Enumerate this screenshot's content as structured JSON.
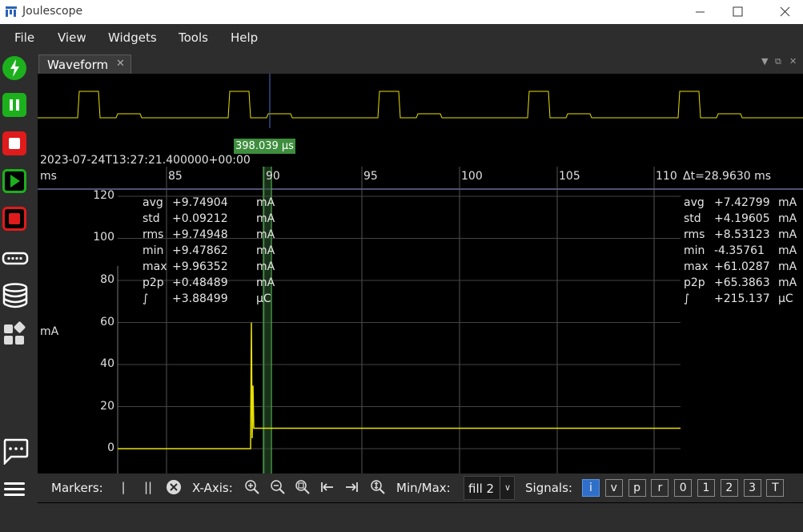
{
  "window": {
    "title": "Joulescope",
    "minimize": "—",
    "maximize": "☐",
    "close": "✕"
  },
  "menu": [
    "File",
    "View",
    "Widgets",
    "Tools",
    "Help"
  ],
  "sidebar": [
    {
      "name": "energy-icon",
      "color": "#1db01d"
    },
    {
      "name": "pause-icon",
      "color": "#1db01d"
    },
    {
      "name": "stop-icon",
      "color": "#e01b1b"
    },
    {
      "name": "play-icon",
      "color": "#1db01d"
    },
    {
      "name": "record-icon",
      "color": "#e01b1b"
    },
    {
      "name": "device-icon",
      "color": "#ffffff"
    },
    {
      "name": "database-icon",
      "color": "#ffffff"
    },
    {
      "name": "widgets-icon",
      "color": "#ffffff"
    },
    {
      "name": "chat-icon",
      "color": "#ffffff"
    },
    {
      "name": "hamburger-menu-icon",
      "color": "#ffffff"
    }
  ],
  "tab": {
    "label": "Waveform",
    "close": "✕"
  },
  "waveform": {
    "marker_flag": "398.039 µs",
    "timestamp": "2023-07-24T13:27:21.400000+00:00",
    "x_unit": "ms",
    "x_ticks": [
      "85",
      "90",
      "95",
      "100",
      "105",
      "110"
    ],
    "dt_label": "Δt=28.9630 ms",
    "y_label": "mA",
    "y_ticks": [
      "120",
      "100",
      "80",
      "60",
      "40",
      "20",
      "0"
    ],
    "stats_left": [
      {
        "k": "avg",
        "v": "+9.74904",
        "u": "mA"
      },
      {
        "k": "std",
        "v": "+0.09212",
        "u": "mA"
      },
      {
        "k": "rms",
        "v": "+9.74948",
        "u": "mA"
      },
      {
        "k": "min",
        "v": "+9.47862",
        "u": "mA"
      },
      {
        "k": "max",
        "v": "+9.96352",
        "u": "mA"
      },
      {
        "k": "p2p",
        "v": "+0.48489",
        "u": "mA"
      },
      {
        "k": "∫",
        "v": "+3.88499",
        "u": "µC"
      }
    ],
    "stats_right": [
      {
        "k": "avg",
        "v": "+7.42799",
        "u": "mA"
      },
      {
        "k": "std",
        "v": "+4.19605",
        "u": "mA"
      },
      {
        "k": "rms",
        "v": "+8.53123",
        "u": "mA"
      },
      {
        "k": "min",
        "v": "-4.35761",
        "u": "mA"
      },
      {
        "k": "max",
        "v": "+61.0287",
        "u": "mA"
      },
      {
        "k": "p2p",
        "v": "+65.3863",
        "u": "mA"
      },
      {
        "k": "∫",
        "v": "+215.137",
        "u": "µC"
      }
    ]
  },
  "toolbar": {
    "markers_label": "Markers:",
    "single_marker": "|",
    "dual_marker": "||",
    "xaxis_label": "X-Axis:",
    "minmax_label": "Min/Max:",
    "minmax_value": "fill 2",
    "signals_label": "Signals:",
    "signals": [
      {
        "label": "i",
        "active": true
      },
      {
        "label": "v",
        "active": false
      },
      {
        "label": "p",
        "active": false
      },
      {
        "label": "r",
        "active": false
      },
      {
        "label": "0",
        "active": false
      },
      {
        "label": "1",
        "active": false
      },
      {
        "label": "2",
        "active": false
      },
      {
        "label": "3",
        "active": false
      },
      {
        "label": "T",
        "active": false
      }
    ]
  },
  "colors": {
    "trace": "#e8e000",
    "marker": "#3e8e3e",
    "grid": "#3a3a3a",
    "accent": "#2f6fc9"
  }
}
